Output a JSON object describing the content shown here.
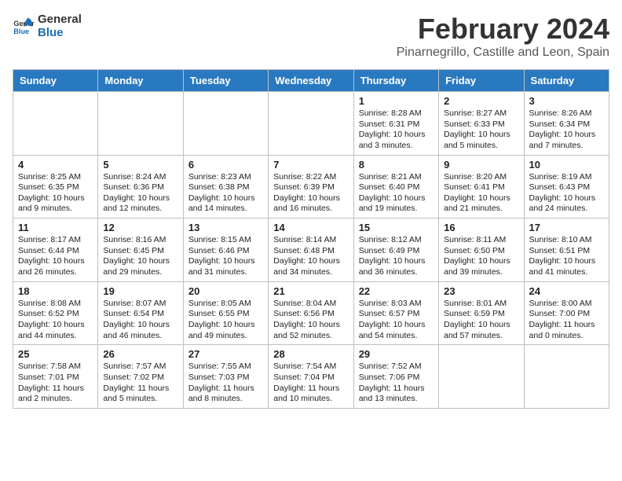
{
  "logo": {
    "line1": "General",
    "line2": "Blue"
  },
  "title": "February 2024",
  "location": "Pinarnegrillo, Castille and Leon, Spain",
  "days_of_week": [
    "Sunday",
    "Monday",
    "Tuesday",
    "Wednesday",
    "Thursday",
    "Friday",
    "Saturday"
  ],
  "weeks": [
    [
      {
        "day": "",
        "info": ""
      },
      {
        "day": "",
        "info": ""
      },
      {
        "day": "",
        "info": ""
      },
      {
        "day": "",
        "info": ""
      },
      {
        "day": "1",
        "info": "Sunrise: 8:28 AM\nSunset: 6:31 PM\nDaylight: 10 hours and 3 minutes."
      },
      {
        "day": "2",
        "info": "Sunrise: 8:27 AM\nSunset: 6:33 PM\nDaylight: 10 hours and 5 minutes."
      },
      {
        "day": "3",
        "info": "Sunrise: 8:26 AM\nSunset: 6:34 PM\nDaylight: 10 hours and 7 minutes."
      }
    ],
    [
      {
        "day": "4",
        "info": "Sunrise: 8:25 AM\nSunset: 6:35 PM\nDaylight: 10 hours and 9 minutes."
      },
      {
        "day": "5",
        "info": "Sunrise: 8:24 AM\nSunset: 6:36 PM\nDaylight: 10 hours and 12 minutes."
      },
      {
        "day": "6",
        "info": "Sunrise: 8:23 AM\nSunset: 6:38 PM\nDaylight: 10 hours and 14 minutes."
      },
      {
        "day": "7",
        "info": "Sunrise: 8:22 AM\nSunset: 6:39 PM\nDaylight: 10 hours and 16 minutes."
      },
      {
        "day": "8",
        "info": "Sunrise: 8:21 AM\nSunset: 6:40 PM\nDaylight: 10 hours and 19 minutes."
      },
      {
        "day": "9",
        "info": "Sunrise: 8:20 AM\nSunset: 6:41 PM\nDaylight: 10 hours and 21 minutes."
      },
      {
        "day": "10",
        "info": "Sunrise: 8:19 AM\nSunset: 6:43 PM\nDaylight: 10 hours and 24 minutes."
      }
    ],
    [
      {
        "day": "11",
        "info": "Sunrise: 8:17 AM\nSunset: 6:44 PM\nDaylight: 10 hours and 26 minutes."
      },
      {
        "day": "12",
        "info": "Sunrise: 8:16 AM\nSunset: 6:45 PM\nDaylight: 10 hours and 29 minutes."
      },
      {
        "day": "13",
        "info": "Sunrise: 8:15 AM\nSunset: 6:46 PM\nDaylight: 10 hours and 31 minutes."
      },
      {
        "day": "14",
        "info": "Sunrise: 8:14 AM\nSunset: 6:48 PM\nDaylight: 10 hours and 34 minutes."
      },
      {
        "day": "15",
        "info": "Sunrise: 8:12 AM\nSunset: 6:49 PM\nDaylight: 10 hours and 36 minutes."
      },
      {
        "day": "16",
        "info": "Sunrise: 8:11 AM\nSunset: 6:50 PM\nDaylight: 10 hours and 39 minutes."
      },
      {
        "day": "17",
        "info": "Sunrise: 8:10 AM\nSunset: 6:51 PM\nDaylight: 10 hours and 41 minutes."
      }
    ],
    [
      {
        "day": "18",
        "info": "Sunrise: 8:08 AM\nSunset: 6:52 PM\nDaylight: 10 hours and 44 minutes."
      },
      {
        "day": "19",
        "info": "Sunrise: 8:07 AM\nSunset: 6:54 PM\nDaylight: 10 hours and 46 minutes."
      },
      {
        "day": "20",
        "info": "Sunrise: 8:05 AM\nSunset: 6:55 PM\nDaylight: 10 hours and 49 minutes."
      },
      {
        "day": "21",
        "info": "Sunrise: 8:04 AM\nSunset: 6:56 PM\nDaylight: 10 hours and 52 minutes."
      },
      {
        "day": "22",
        "info": "Sunrise: 8:03 AM\nSunset: 6:57 PM\nDaylight: 10 hours and 54 minutes."
      },
      {
        "day": "23",
        "info": "Sunrise: 8:01 AM\nSunset: 6:59 PM\nDaylight: 10 hours and 57 minutes."
      },
      {
        "day": "24",
        "info": "Sunrise: 8:00 AM\nSunset: 7:00 PM\nDaylight: 11 hours and 0 minutes."
      }
    ],
    [
      {
        "day": "25",
        "info": "Sunrise: 7:58 AM\nSunset: 7:01 PM\nDaylight: 11 hours and 2 minutes."
      },
      {
        "day": "26",
        "info": "Sunrise: 7:57 AM\nSunset: 7:02 PM\nDaylight: 11 hours and 5 minutes."
      },
      {
        "day": "27",
        "info": "Sunrise: 7:55 AM\nSunset: 7:03 PM\nDaylight: 11 hours and 8 minutes."
      },
      {
        "day": "28",
        "info": "Sunrise: 7:54 AM\nSunset: 7:04 PM\nDaylight: 11 hours and 10 minutes."
      },
      {
        "day": "29",
        "info": "Sunrise: 7:52 AM\nSunset: 7:06 PM\nDaylight: 11 hours and 13 minutes."
      },
      {
        "day": "",
        "info": ""
      },
      {
        "day": "",
        "info": ""
      }
    ]
  ]
}
